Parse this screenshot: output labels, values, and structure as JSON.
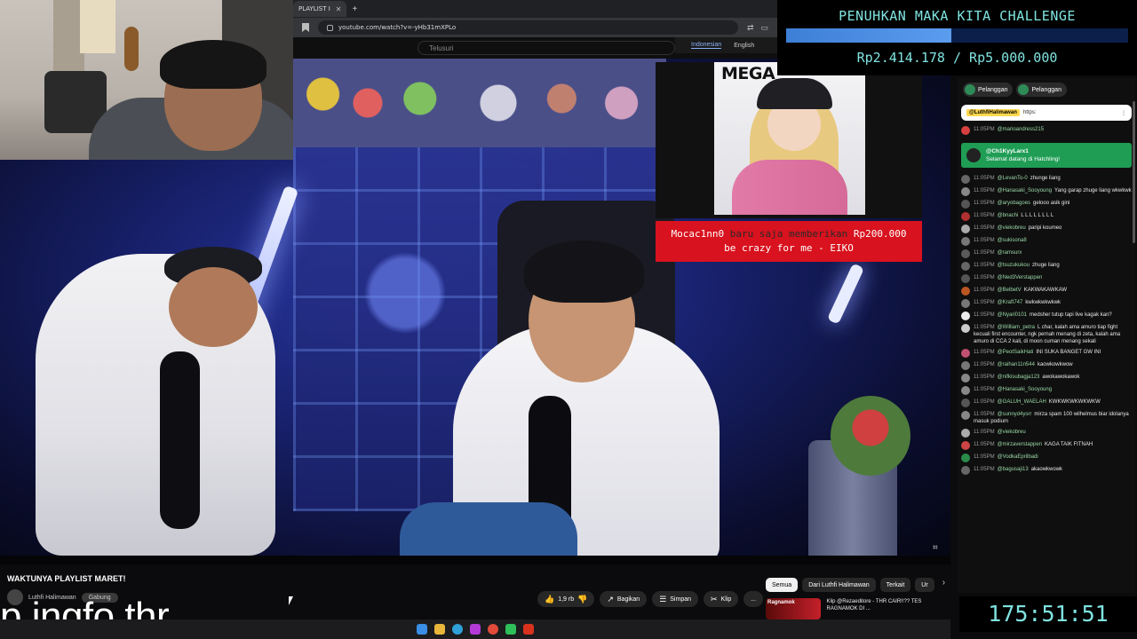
{
  "browser": {
    "tab_label": "PLAYLIST I",
    "url": "youtube.com/watch?v=-yHb31mXPLo",
    "search_placeholder": "Telusuri",
    "lang_active": "Indonesian",
    "lang_other": "English"
  },
  "goal": {
    "title": "PENUHKAN MAKA KITA CHALLENGE",
    "amount_text": "Rp2.414.178 / Rp5.000.000",
    "progress": 0.483
  },
  "poster": {
    "title": "MEGA"
  },
  "donation": {
    "name": "Mocac1nn0",
    "mid": " baru saja memberikan ",
    "amount": "Rp200.000",
    "message": "be crazy for me - EIKO"
  },
  "chat": {
    "chip1": "Pelanggan",
    "chip2": "Pelanggan",
    "pinned_tag": "@LuthfiHalimawan",
    "pinned_text": "https:",
    "welcome_author": "@Ch1KyyLarx1",
    "welcome_text": "Selamat datang di Hatchling!",
    "messages": [
      {
        "time": "11:05PM",
        "author": "@marioandress215",
        "text": "",
        "color": "#d84040"
      },
      {
        "time": "11:05PM",
        "author": "@LevanTo-0",
        "text": "zhunge liang",
        "color": "#666"
      },
      {
        "time": "11:05PM",
        "author": "@Hanasaki_Sooyoung",
        "text": "Yang garap zhuge liang wkwkwk",
        "color": "#888"
      },
      {
        "time": "11:05PM",
        "author": "@aryobagoes",
        "text": "gelooo asik gini",
        "color": "#555"
      },
      {
        "time": "11:05PM",
        "author": "@bnachi",
        "text": "L L L L L L L L",
        "color": "#b03030"
      },
      {
        "time": "11:05PM",
        "author": "@viekobreu",
        "text": "paripi koumeo",
        "color": "#aaa"
      },
      {
        "time": "11:05PM",
        "author": "@sukisona8",
        "text": "",
        "color": "#777"
      },
      {
        "time": "11:05PM",
        "author": "@ramsurx",
        "text": "",
        "color": "#5a5a5a"
      },
      {
        "time": "11:05PM",
        "author": "@tsuzukukou",
        "text": "zhuge liang",
        "color": "#666"
      },
      {
        "time": "11:05PM",
        "author": "@Ned3Verstappen",
        "text": "",
        "color": "#555"
      },
      {
        "time": "11:05PM",
        "author": "@BelbetV",
        "text": "KAKWAKAWKAW",
        "color": "#bb5522"
      },
      {
        "time": "11:05PM",
        "author": "@Kraft747",
        "text": "kwkwkwkwkwk",
        "color": "#777"
      },
      {
        "time": "11:05PM",
        "author": "@Nyari0101",
        "text": "medsher tutup tapi live kagak kan?",
        "color": "#eee"
      },
      {
        "time": "11:05PM",
        "author": "@William_petra",
        "text": "L char, kalah ama amuro tiap fight kecuali first encounter, ngk pernah menang di zeta, kalah ama amuro di CCA 2 kali, di moon cuman menang sekali",
        "color": "#ccc"
      },
      {
        "time": "11:05PM",
        "author": "@PeotSaikHati",
        "text": "INI SUKA BANGET GW INI",
        "color": "#c05070"
      },
      {
        "time": "11:05PM",
        "author": "@raihan11n544",
        "text": "kaowkowkwow",
        "color": "#777"
      },
      {
        "time": "11:05PM",
        "author": "@nifkisubagja123",
        "text": "awokawokawok",
        "color": "#888"
      },
      {
        "time": "11:05PM",
        "author": "@Hanasaki_Sooyoung",
        "text": "",
        "color": "#888"
      },
      {
        "time": "11:05PM",
        "author": "@GALUH_WAELAH",
        "text": "KWKWKWKWKWKW",
        "color": "#555"
      },
      {
        "time": "11:05PM",
        "author": "@sunnyd4ysrr",
        "text": "mirza spam 100 wilhelmus biar idolanya masuk podium",
        "color": "#888"
      },
      {
        "time": "11:05PM",
        "author": "@viekobreu",
        "text": "",
        "color": "#aaa"
      },
      {
        "time": "11:05PM",
        "author": "@mirzaverstappen",
        "text": "KAGA TAIK FITNAH",
        "color": "#cc4444"
      },
      {
        "time": "11:05PM",
        "author": "@VodkaEprilbadi",
        "text": "",
        "color": "#2a8a4a"
      },
      {
        "time": "11:05PM",
        "author": "@bagusaji13",
        "text": "akaowkwowk",
        "color": "#666"
      }
    ]
  },
  "video": {
    "title": "WAKTUNYA PLAYLIST MARET!",
    "channel": "Luthfi Halimawan",
    "join_label": "Gabung",
    "caption": "p ingfo thr",
    "likes": "1,9 rb",
    "share_label": "Bagikan",
    "save_label": "Simpan",
    "clip_label": "Klip",
    "more_label": "..."
  },
  "recs": {
    "filters": [
      "Semua",
      "Dari Luthfi Halimawan",
      "Terkait",
      "Ur"
    ],
    "rec_title": "Klip @Rezaeditore - THR CAIR!!?? TES RAGNAMOK DI ...",
    "rec_thumb_text": "Ragnamok"
  },
  "timer": "175:51:51"
}
